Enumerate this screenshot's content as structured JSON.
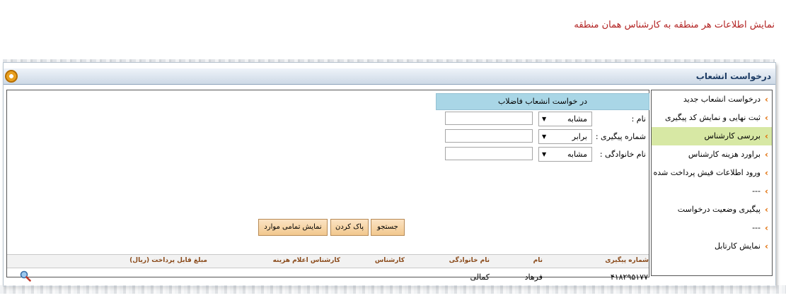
{
  "caption": "نمایش اطلاعات هر منطقه به کارشناس همان منطقه",
  "window": {
    "title": "درخواست انشعاب",
    "icon": "gear-icon"
  },
  "sidebar": {
    "items": [
      {
        "label": "درخواست انشعاب جدید",
        "selected": false
      },
      {
        "label": "ثبت نهایی و نمایش کد پیگیری",
        "selected": false
      },
      {
        "label": "بررسی کارشناس",
        "selected": true
      },
      {
        "label": "براورد هزینه کارشناس",
        "selected": false
      },
      {
        "label": "ورود اطلاعات فیش پرداخت شده",
        "selected": false
      },
      {
        "label": "---",
        "selected": false
      },
      {
        "label": "پیگیری وضعیت درخواست",
        "selected": false
      },
      {
        "label": "---",
        "selected": false
      },
      {
        "label": "نمایش کارتابل",
        "selected": false
      }
    ]
  },
  "form": {
    "header": "در خواست انشعاب فاضلاب",
    "fields": [
      {
        "label": "نام :",
        "operator": "مشابه",
        "value": ""
      },
      {
        "label": "شماره پیگیری :",
        "operator": "برابر",
        "value": ""
      },
      {
        "label": "نام خانوادگی :",
        "operator": "مشابه",
        "value": ""
      }
    ]
  },
  "buttons": {
    "search": "جستجو",
    "clear": "پاک کردن",
    "show_all": "نمایش تمامی موارد"
  },
  "table": {
    "columns": [
      "شماره پیگیری",
      "نام",
      "نام خانوادگی",
      "کارشناس",
      "کارشناس اعلام هزینه",
      "مبلغ قابل پرداخت (ریال)"
    ],
    "rows": [
      {
        "tracking": "۴۱۸۲۹۵۱۷۷",
        "first_name": "فرهاد",
        "last_name": "کمالی",
        "expert": "",
        "cost_expert": "",
        "amount": ""
      }
    ]
  },
  "colors": {
    "caption": "#b22222",
    "selected_item": "#d7e8a4",
    "form_header": "#a9d6e6",
    "button": "#f2c88e",
    "arrow": "#e06a00"
  }
}
